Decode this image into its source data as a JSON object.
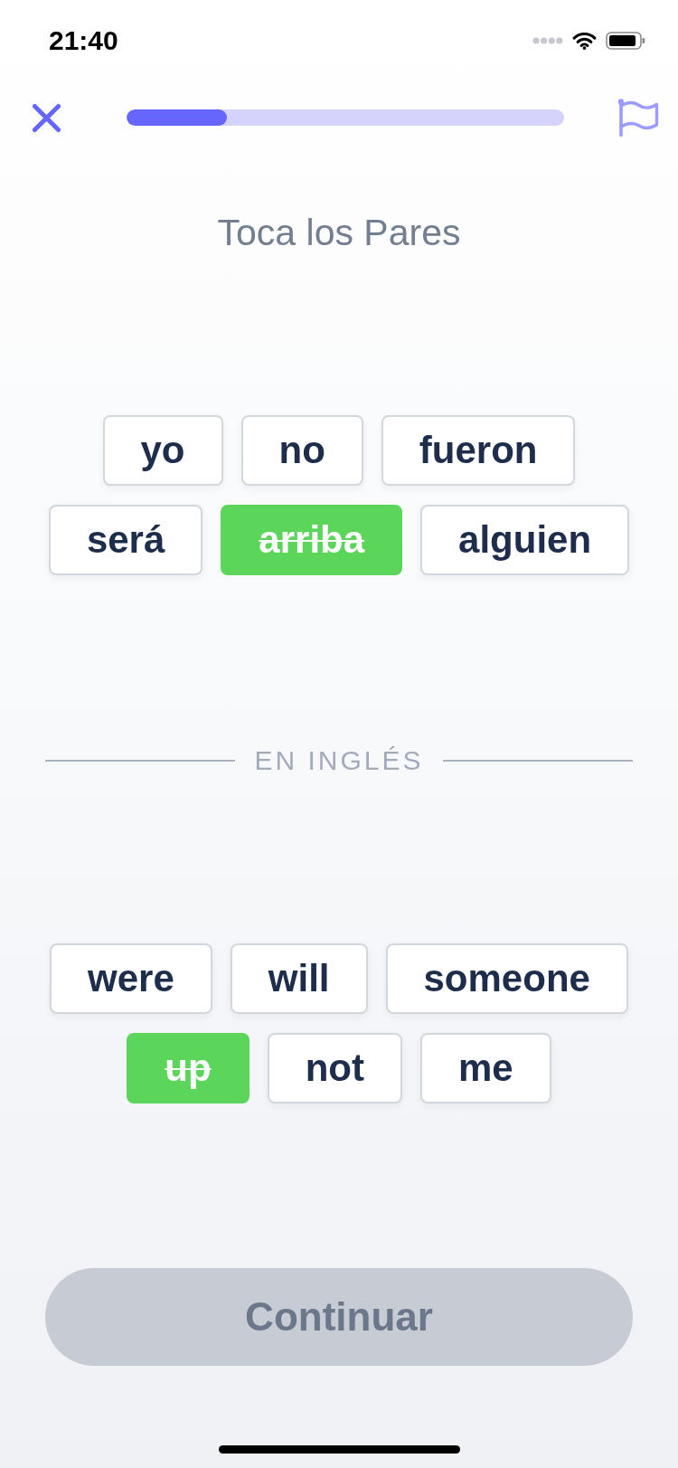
{
  "status_bar": {
    "time": "21:40"
  },
  "progress": {
    "level": 0.23
  },
  "title": "Toca los Pares",
  "spanish_words": [
    {
      "text": "yo",
      "matched": false
    },
    {
      "text": "no",
      "matched": false
    },
    {
      "text": "fueron",
      "matched": false
    },
    {
      "text": "será",
      "matched": false
    },
    {
      "text": "arriba",
      "matched": true
    },
    {
      "text": "alguien",
      "matched": false
    }
  ],
  "divider_label": "EN INGLÉS",
  "english_words": [
    {
      "text": "were",
      "matched": false
    },
    {
      "text": "will",
      "matched": false
    },
    {
      "text": "someone",
      "matched": false
    },
    {
      "text": "up",
      "matched": true
    },
    {
      "text": "not",
      "matched": false
    },
    {
      "text": "me",
      "matched": false
    }
  ],
  "continue_button": {
    "label": "Continuar",
    "disabled": true
  }
}
